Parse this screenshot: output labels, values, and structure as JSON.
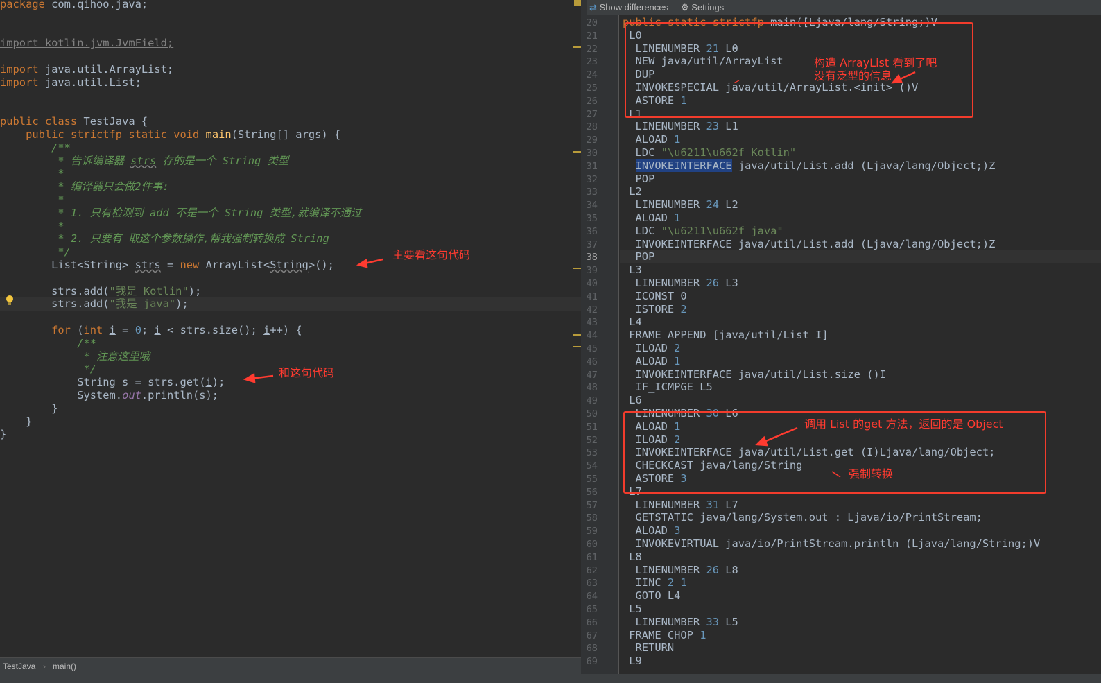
{
  "left_code": [
    "<span class='kw'>package</span> com.qihoo.java;",
    "",
    "",
    "<span class='gray uline'>import kotlin.jvm.JvmField;</span>",
    "",
    "<span class='kw'>import</span> java.util.ArrayList;",
    "<span class='kw'>import</span> java.util.List;",
    "",
    "",
    "<span class='kw'>public class</span> TestJava {",
    "    <span class='kw'>public strictfp static void</span> <span class='fn'>main</span>(String[] args) {",
    "        <span class='cm'>/**</span>",
    "<span class='cm'>         * 告诉编译器 <span class='warn'>strs</span> 存的是一个 String 类型</span>",
    "<span class='cm'>         *</span>",
    "<span class='cm'>         * 编译器只会做2件事:</span>",
    "<span class='cm'>         *</span>",
    "<span class='cm'>         * 1. 只有检测到 add 不是一个 String 类型,就编译不通过</span>",
    "<span class='cm'>         *</span>",
    "<span class='cm'>         * 2. 只要有 取这个参数操作,帮我强制转换成 String</span>",
    "<span class='cm'>         */</span>",
    "        List&lt;String&gt; <span class='warn'>strs</span> = <span class='kw'>new</span> ArrayList&lt;<span class='warn'>String</span>&gt;();",
    "",
    "        strs.add(<span class='str'>\"我是 Kotlin\"</span>);",
    "        strs.add(<span class='str'>\"我是 java\"</span>);",
    "",
    "        <span class='kw'>for</span> (<span class='kw'>int</span> <span class='uline'>i</span> = <span class='num'>0</span>; <span class='uline'>i</span> &lt; strs.size(); <span class='uline'>i</span>++) {",
    "            <span class='cm'>/**</span>",
    "<span class='cm'>             * 注意这里哦</span>",
    "<span class='cm'>             */</span>",
    "            String s = strs.get(<span class='uline'>i</span>);",
    "            System.<span class='fld'>out</span>.println(s);",
    "        }",
    "    }",
    "}"
  ],
  "toolbar": {
    "show_differences": "Show differences",
    "settings": "Settings"
  },
  "right_start_line": 20,
  "right_code": [
    "<span style='color:#cc7832'>public static strictfp</span> main([Ljava/lang/String;)V",
    " L0",
    "  LINENUMBER <span class='num'>21</span> L0",
    "  NEW java/util/ArrayList",
    "  DUP",
    "  INVOKESPECIAL java/util/ArrayList.&lt;init&gt; ()V",
    "  ASTORE <span class='num'>1</span>",
    " L1",
    "  LINENUMBER <span class='num'>23</span> L1",
    "  ALOAD <span class='num'>1</span>",
    "  LDC <span class='str'>\"\\u6211\\u662f Kotlin\"</span>",
    "  <span class='hl'>INVOKEINTERFACE</span> java/util/List.add (Ljava/lang/Object;)Z",
    "  POP",
    " L2",
    "  LINENUMBER <span class='num'>24</span> L2",
    "  ALOAD <span class='num'>1</span>",
    "  LDC <span class='str'>\"\\u6211\\u662f java\"</span>",
    "  INVOKEINTERFACE java/util/List.add (Ljava/lang/Object;)Z",
    "  POP",
    " L3",
    "  LINENUMBER <span class='num'>26</span> L3",
    "  ICONST_0",
    "  ISTORE <span class='num'>2</span>",
    " L4",
    " FRAME APPEND [java/util/List I]",
    "  ILOAD <span class='num'>2</span>",
    "  ALOAD <span class='num'>1</span>",
    "  INVOKEINTERFACE java/util/List.size ()I",
    "  IF_ICMPGE L5",
    " L6",
    "  LINENUMBER <span class='num'>30</span> L6",
    "  ALOAD <span class='num'>1</span>",
    "  ILOAD <span class='num'>2</span>",
    "  INVOKEINTERFACE java/util/List.get (I)Ljava/lang/Object;",
    "  CHECKCAST java/lang/String",
    "  ASTORE <span class='num'>3</span>",
    " L7",
    "  LINENUMBER <span class='num'>31</span> L7",
    "  GETSTATIC java/lang/System.out : Ljava/io/PrintStream;",
    "  ALOAD <span class='num'>3</span>",
    "  INVOKEVIRTUAL java/io/PrintStream.println (Ljava/lang/String;)V",
    " L8",
    "  LINENUMBER <span class='num'>26</span> L8",
    "  IINC <span class='num'>2</span> <span class='num'>1</span>",
    "  GOTO L4",
    " L5",
    "  LINENUMBER <span class='num'>33</span> L5",
    " FRAME CHOP <span class='num'>1</span>",
    "  RETURN",
    " L9"
  ],
  "annotations": {
    "main_code": "主要看这句代码",
    "and_code": "和这句代码",
    "arraylist_1": "构造 ArrayList 看到了吧",
    "arraylist_2": "没有泛型的信息",
    "get_method": "调用 List 的get 方法，返回的是 Object",
    "cast": "强制转换"
  },
  "statusbar": {
    "file": "TestJava",
    "method": "main()"
  }
}
